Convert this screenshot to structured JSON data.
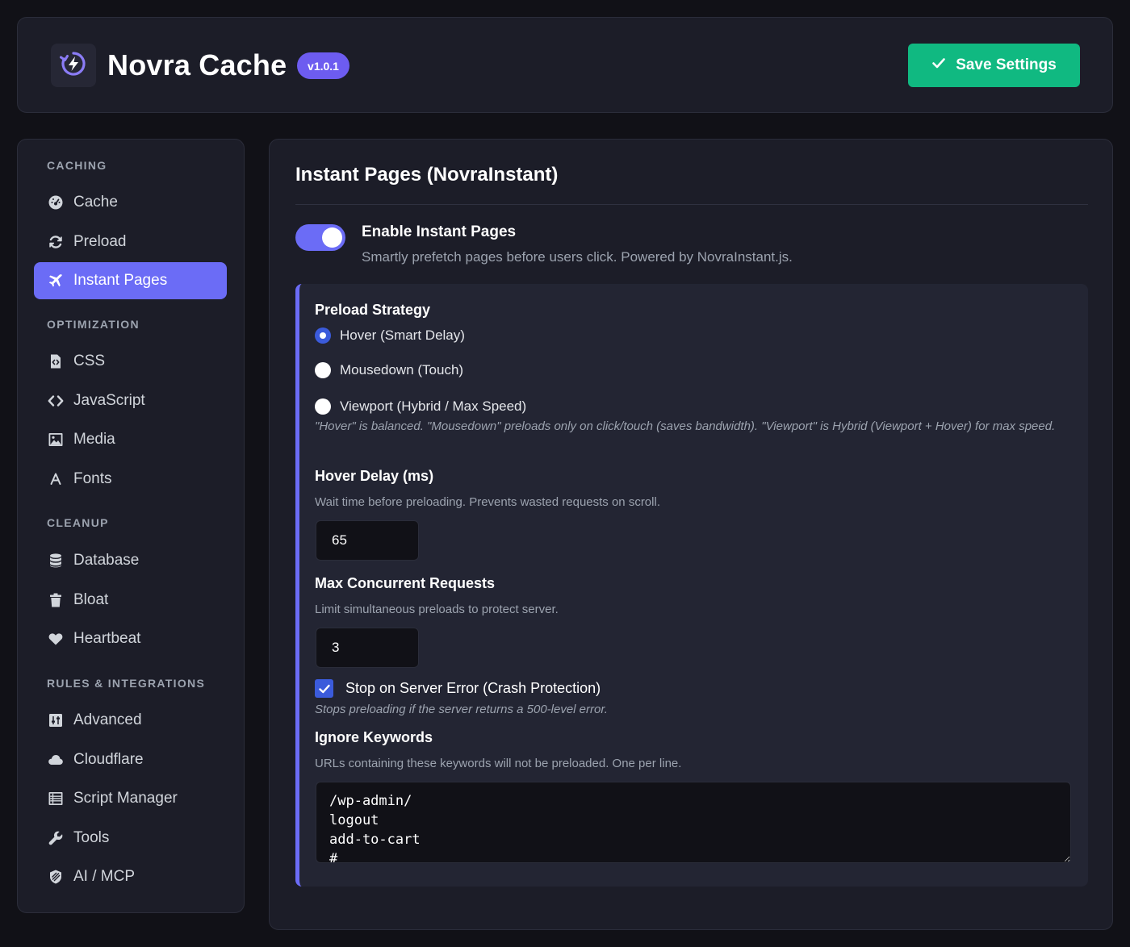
{
  "header": {
    "title": "Novra Cache",
    "version": "v1.0.1",
    "logo_icon": "bolt-refresh-icon",
    "save_label": "Save Settings",
    "save_icon": "check-icon"
  },
  "sidebar": {
    "sections": [
      {
        "heading": "CACHING",
        "items": [
          {
            "label": "Cache",
            "icon": "gauge-icon"
          },
          {
            "label": "Preload",
            "icon": "sync-icon"
          },
          {
            "label": "Instant Pages",
            "icon": "plane-icon",
            "active": true
          }
        ]
      },
      {
        "heading": "OPTIMIZATION",
        "items": [
          {
            "label": "CSS",
            "icon": "file-code-icon"
          },
          {
            "label": "JavaScript",
            "icon": "code-icon"
          },
          {
            "label": "Media",
            "icon": "image-icon"
          },
          {
            "label": "Fonts",
            "icon": "font-icon"
          }
        ]
      },
      {
        "heading": "CLEANUP",
        "items": [
          {
            "label": "Database",
            "icon": "database-icon"
          },
          {
            "label": "Bloat",
            "icon": "trash-icon"
          },
          {
            "label": "Heartbeat",
            "icon": "heart-icon"
          }
        ]
      },
      {
        "heading": "RULES & INTEGRATIONS",
        "items": [
          {
            "label": "Advanced",
            "icon": "sliders-icon"
          },
          {
            "label": "Cloudflare",
            "icon": "cloud-icon"
          },
          {
            "label": "Script Manager",
            "icon": "list-icon"
          },
          {
            "label": "Tools",
            "icon": "wrench-icon"
          },
          {
            "label": "AI / MCP",
            "icon": "robot-icon"
          }
        ]
      }
    ]
  },
  "main": {
    "title": "Instant Pages (NovraInstant)",
    "enable": {
      "label": "Enable Instant Pages",
      "description": "Smartly prefetch pages before users click. Powered by NovraInstant.js.",
      "on": true
    },
    "strategy": {
      "label": "Preload Strategy",
      "options": [
        {
          "label": "Hover (Smart Delay)",
          "checked": true
        },
        {
          "label": "Mousedown (Touch)",
          "checked": false
        },
        {
          "label": "Viewport (Hybrid / Max Speed)",
          "checked": false
        }
      ],
      "hint": "\"Hover\" is balanced. \"Mousedown\" preloads only on click/touch (saves bandwidth). \"Viewport\" is Hybrid (Viewport + Hover) for max speed."
    },
    "hover_delay": {
      "label": "Hover Delay (ms)",
      "description": "Wait time before preloading. Prevents wasted requests on scroll.",
      "value": "65"
    },
    "max_concurrent": {
      "label": "Max Concurrent Requests",
      "description": "Limit simultaneous preloads to protect server.",
      "value": "3"
    },
    "stop_on_error": {
      "label": "Stop on Server Error (Crash Protection)",
      "hint": "Stops preloading if the server returns a 500-level error.",
      "checked": true
    },
    "ignore_keywords": {
      "label": "Ignore Keywords",
      "description": "URLs containing these keywords will not be preloaded. One per line.",
      "value": "/wp-admin/\nlogout\nadd-to-cart\n#"
    }
  },
  "colors": {
    "accent": "#6b6cf6",
    "save_button": "#10b981",
    "background": "#111117",
    "card": "#1c1d28"
  }
}
